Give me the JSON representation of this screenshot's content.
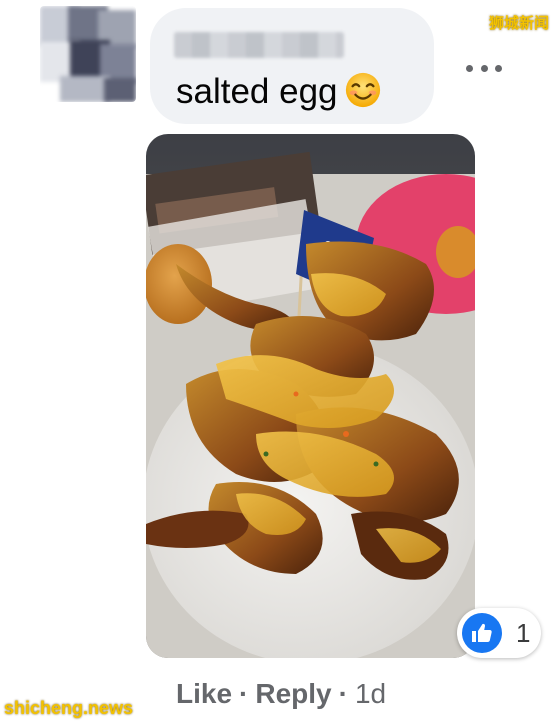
{
  "comment": {
    "text": "salted egg",
    "emoji_icon": "smiling-face-emoji"
  },
  "reaction": {
    "icon": "like-icon",
    "count": "1",
    "color": "#1877f2"
  },
  "actions": {
    "like_label": "Like",
    "reply_label": "Reply",
    "separator": "·",
    "timestamp": "1d"
  },
  "watermarks": {
    "top": "狮城新闻",
    "bottom": "shicheng.news"
  },
  "colors": {
    "bubble": "#f0f2f5",
    "secondary_text": "#65676b",
    "watermark": "#f3c200"
  }
}
